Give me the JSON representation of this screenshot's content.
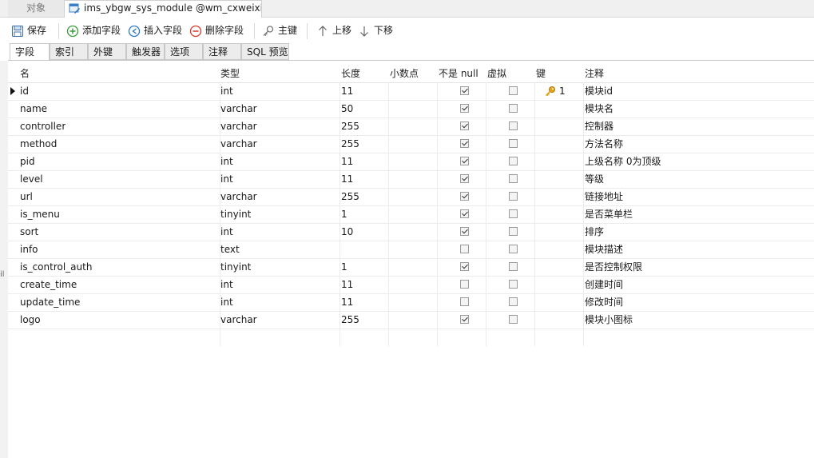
{
  "window": {
    "tab_object": "对象",
    "tab_document": "ims_ybgw_sys_module @wm_cxweixi..."
  },
  "toolbar": {
    "save": "保存",
    "add_field": "添加字段",
    "insert_field": "插入字段",
    "delete_field": "删除字段",
    "primary_key": "主键",
    "move_up": "上移",
    "move_down": "下移"
  },
  "subtabs": [
    "字段",
    "索引",
    "外键",
    "触发器",
    "选项",
    "注释",
    "SQL 预览"
  ],
  "columns": {
    "name": "名",
    "type": "类型",
    "length": "长度",
    "decimal": "小数点",
    "not_null": "不是 null",
    "virtual": "虚拟",
    "key": "键",
    "comment": "注释"
  },
  "rows": [
    {
      "name": "id",
      "type": "int",
      "length": "11",
      "decimal": "",
      "not_null": true,
      "virtual": false,
      "key": "1",
      "comment": "模块id"
    },
    {
      "name": "name",
      "type": "varchar",
      "length": "50",
      "decimal": "",
      "not_null": true,
      "virtual": false,
      "key": "",
      "comment": "模块名"
    },
    {
      "name": "controller",
      "type": "varchar",
      "length": "255",
      "decimal": "",
      "not_null": true,
      "virtual": false,
      "key": "",
      "comment": "控制器"
    },
    {
      "name": "method",
      "type": "varchar",
      "length": "255",
      "decimal": "",
      "not_null": true,
      "virtual": false,
      "key": "",
      "comment": "方法名称"
    },
    {
      "name": "pid",
      "type": "int",
      "length": "11",
      "decimal": "",
      "not_null": true,
      "virtual": false,
      "key": "",
      "comment": "上级名称 0为顶级"
    },
    {
      "name": "level",
      "type": "int",
      "length": "11",
      "decimal": "",
      "not_null": true,
      "virtual": false,
      "key": "",
      "comment": "等级"
    },
    {
      "name": "url",
      "type": "varchar",
      "length": "255",
      "decimal": "",
      "not_null": true,
      "virtual": false,
      "key": "",
      "comment": "链接地址"
    },
    {
      "name": "is_menu",
      "type": "tinyint",
      "length": "1",
      "decimal": "",
      "not_null": true,
      "virtual": false,
      "key": "",
      "comment": "是否菜单栏"
    },
    {
      "name": "sort",
      "type": "int",
      "length": "10",
      "decimal": "",
      "not_null": true,
      "virtual": false,
      "key": "",
      "comment": "排序"
    },
    {
      "name": "info",
      "type": "text",
      "length": "",
      "decimal": "",
      "not_null": false,
      "virtual": false,
      "key": "",
      "comment": "模块描述"
    },
    {
      "name": "is_control_auth",
      "type": "tinyint",
      "length": "1",
      "decimal": "",
      "not_null": true,
      "virtual": false,
      "key": "",
      "comment": "是否控制权限"
    },
    {
      "name": "create_time",
      "type": "int",
      "length": "11",
      "decimal": "",
      "not_null": false,
      "virtual": false,
      "key": "",
      "comment": "创建时间"
    },
    {
      "name": "update_time",
      "type": "int",
      "length": "11",
      "decimal": "",
      "not_null": false,
      "virtual": false,
      "key": "",
      "comment": "修改时间"
    },
    {
      "name": "logo",
      "type": "varchar",
      "length": "255",
      "decimal": "",
      "not_null": true,
      "virtual": false,
      "key": "",
      "comment": "模块小图标"
    }
  ],
  "icons": {
    "save": "save-icon",
    "add": "add-circle-icon",
    "insert": "insert-circle-icon",
    "delete": "delete-circle-icon",
    "key": "key-icon",
    "up": "arrow-up-icon",
    "down": "arrow-down-icon"
  },
  "colors": {
    "add": "#3a9a3a",
    "insert": "#2a78c8",
    "delete": "#d03a2a",
    "key": "#e3a21a"
  }
}
